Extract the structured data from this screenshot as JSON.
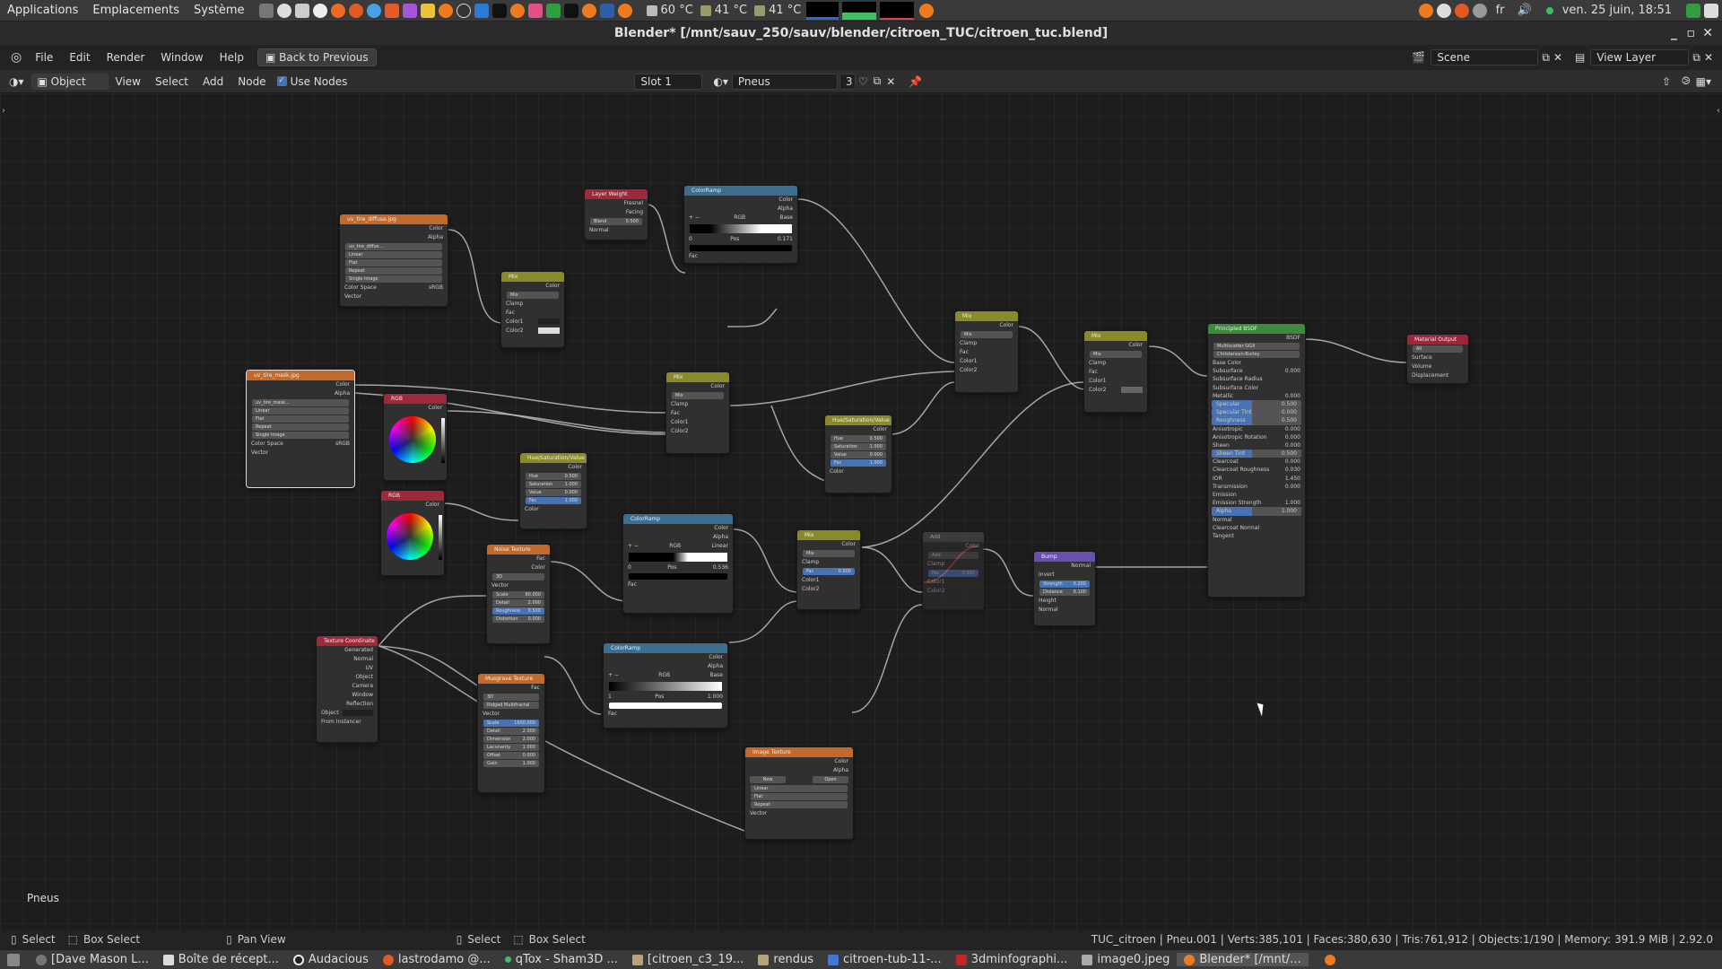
{
  "os_panel": {
    "menus": [
      "Applications",
      "Emplacements",
      "Système"
    ],
    "temps": [
      "60 °C",
      "41 °C",
      "41 °C"
    ],
    "lang": "fr",
    "clock": "ven. 25 juin, 18:51"
  },
  "window": {
    "title": "Blender* [/mnt/sauv_250/sauv/blender/citroen_TUC/citroen_tuc.blend]"
  },
  "topbar": {
    "menus": [
      "File",
      "Edit",
      "Render",
      "Window",
      "Help"
    ],
    "back_button": "Back to Previous",
    "scene": "Scene",
    "view_layer": "View Layer"
  },
  "node_header": {
    "mode": "Object",
    "menus": [
      "View",
      "Select",
      "Add",
      "Node"
    ],
    "use_nodes_label": "Use Nodes",
    "slot": "Slot 1",
    "material": "Pneus",
    "user_count": "3"
  },
  "nodes": {
    "tex_diffuse": {
      "title": "uv_tire_diffuse.jpg",
      "image": "uv_tire_diffus...",
      "outputs": [
        "Color",
        "Alpha"
      ],
      "opts": [
        "Linear",
        "Flat",
        "Repeat",
        "Single Image"
      ],
      "colorspace_label": "Color Space",
      "colorspace": "sRGB",
      "input": "Vector"
    },
    "tex_mask": {
      "title": "uv_tire_mask.jpg",
      "image": "uv_tire_mask...",
      "outputs": [
        "Color",
        "Alpha"
      ],
      "opts": [
        "Linear",
        "Flat",
        "Repeat",
        "Single Image"
      ],
      "colorspace_label": "Color Space",
      "colorspace": "sRGB",
      "input": "Vector"
    },
    "layer_weight": {
      "title": "Layer Weight",
      "outputs": [
        "Fresnel",
        "Facing"
      ],
      "blend_label": "Blend",
      "blend": "0.500",
      "input": "Normal"
    },
    "colorramp1": {
      "title": "ColorRamp",
      "outputs": [
        "Color",
        "Alpha"
      ],
      "mode": "RGB",
      "interp": "Base",
      "index": "0",
      "pos_label": "Pos",
      "pos": "0.171",
      "input": "Fac"
    },
    "mix1": {
      "title": "Mix",
      "output": "Color",
      "blend": "Mix",
      "clamp": "Clamp",
      "inputs": [
        "Fac",
        "Color1",
        "Color2"
      ]
    },
    "rgb1": {
      "title": "RGB",
      "output": "Color"
    },
    "rgb2": {
      "title": "RGB",
      "output": "Color"
    },
    "mix2": {
      "title": "Mix",
      "output": "Color",
      "blend": "Mix",
      "clamp": "Clamp",
      "inputs": [
        "Fac",
        "Color1",
        "Color2"
      ]
    },
    "hsv1": {
      "title": "Hue/Saturation/Value",
      "output": "Color",
      "fields": [
        [
          "Hue",
          "0.500"
        ],
        [
          "Saturation",
          "1.000"
        ],
        [
          "Value",
          "0.000"
        ],
        [
          "Fac",
          "1.000"
        ]
      ],
      "input": "Color"
    },
    "hsv2": {
      "title": "Hue/Saturation/Value",
      "output": "Color",
      "fields": [
        [
          "Hue",
          "0.500"
        ],
        [
          "Saturation",
          "1.000"
        ],
        [
          "Value",
          "0.000"
        ],
        [
          "Fac",
          "1.000"
        ]
      ],
      "input": "Color"
    },
    "mix3": {
      "title": "Mix",
      "output": "Color",
      "blend": "Mix",
      "clamp": "Clamp",
      "inputs": [
        "Fac",
        "Color1",
        "Color2"
      ]
    },
    "mix4": {
      "title": "Mix",
      "output": "Color",
      "blend": "Mix",
      "clamp": "Clamp",
      "inputs": [
        "Fac",
        "Color1",
        "Color2"
      ]
    },
    "noise": {
      "title": "Noise Texture",
      "outputs": [
        "Fac",
        "Color"
      ],
      "dim": "3D",
      "input": "Vector",
      "fields": [
        [
          "Scale",
          "80.000"
        ],
        [
          "Detail",
          "2.000"
        ],
        [
          "Roughness",
          "0.500"
        ],
        [
          "Distortion",
          "0.000"
        ]
      ]
    },
    "colorramp2": {
      "title": "ColorRamp",
      "outputs": [
        "Color",
        "Alpha"
      ],
      "mode": "RGB",
      "interp": "Linear",
      "index": "0",
      "pos_label": "Pos",
      "pos": "0.536",
      "input": "Fac"
    },
    "colorramp3": {
      "title": "ColorRamp",
      "outputs": [
        "Color",
        "Alpha"
      ],
      "mode": "RGB",
      "interp": "Base",
      "index": "1",
      "pos_label": "Pos",
      "pos": "1.000",
      "input": "Fac"
    },
    "mix5": {
      "title": "Mix",
      "output": "Color",
      "blend": "Mix",
      "clamp": "Clamp",
      "fac_label": "Fac",
      "fac": "0.500",
      "inputs": [
        "Color1",
        "Color2"
      ]
    },
    "add": {
      "title": "Add",
      "output": "Color",
      "blend": "Add",
      "clamp": "Clamp",
      "fac_label": "Fac",
      "fac": "0.500",
      "inputs": [
        "Color1",
        "Color2"
      ]
    },
    "bump": {
      "title": "Bump",
      "output": "Normal",
      "invert": "Invert",
      "fields": [
        [
          "Strength",
          "0.200"
        ],
        [
          "Distance",
          "0.100"
        ]
      ],
      "inputs": [
        "Height",
        "Normal"
      ]
    },
    "texcoord": {
      "title": "Texture Coordinate",
      "outputs": [
        "Generated",
        "Normal",
        "UV",
        "Object",
        "Camera",
        "Window",
        "Reflection"
      ],
      "object_label": "Object",
      "from_instancer": "From Instancer"
    },
    "musgrave": {
      "title": "Musgrave Texture",
      "output": "Fac",
      "dim": "3D",
      "type": "Ridged Multifractal",
      "input": "Vector",
      "fields": [
        [
          "Scale",
          "1600.000"
        ],
        [
          "Detail",
          "2.000"
        ],
        [
          "Dimension",
          "2.000"
        ],
        [
          "Lacunarity",
          "1.000"
        ],
        [
          "Offset",
          "0.000"
        ],
        [
          "Gain",
          "1.000"
        ]
      ]
    },
    "image_tex": {
      "title": "Image Texture",
      "outputs": [
        "Color",
        "Alpha"
      ],
      "new": "New",
      "open": "Open",
      "opts": [
        "Linear",
        "Flat",
        "Repeat"
      ],
      "input": "Vector"
    },
    "principled": {
      "title": "Principled BSDF",
      "output": "BSDF",
      "dist": "Multiscatter GGX",
      "sss": "Christensen-Burley",
      "fields": [
        [
          "Base Color",
          ""
        ],
        [
          "Subsurface",
          "0.000"
        ],
        [
          "Subsurface Radius",
          ""
        ],
        [
          "Subsurface Color",
          ""
        ],
        [
          "Metallic",
          "0.000"
        ],
        [
          "Specular",
          "0.500"
        ],
        [
          "Specular Tint",
          "0.000"
        ],
        [
          "Roughness",
          "0.500"
        ],
        [
          "Anisotropic",
          "0.000"
        ],
        [
          "Anisotropic Rotation",
          "0.000"
        ],
        [
          "Sheen",
          "0.000"
        ],
        [
          "Sheen Tint",
          "0.500"
        ],
        [
          "Clearcoat",
          "0.000"
        ],
        [
          "Clearcoat Roughness",
          "0.030"
        ],
        [
          "IOR",
          "1.450"
        ],
        [
          "Transmission",
          "0.000"
        ],
        [
          "Emission",
          ""
        ],
        [
          "Emission Strength",
          "1.000"
        ],
        [
          "Alpha",
          "1.000"
        ],
        [
          "Normal",
          ""
        ],
        [
          "Clearcoat Normal",
          ""
        ],
        [
          "Tangent",
          ""
        ]
      ]
    },
    "output": {
      "title": "Material Output",
      "target": "All",
      "inputs": [
        "Surface",
        "Volume",
        "Displacement"
      ]
    }
  },
  "editor_label": "Pneus",
  "statusbar": {
    "items": [
      "Select",
      "Box Select",
      "Pan View",
      "Select",
      "Box Select"
    ],
    "stats": "TUC_citroen | Pneu.001 | Verts:385,101 | Faces:380,630 | Tris:761,912 | Objects:1/190 | Memory: 391.9 MiB | 2.92.0"
  },
  "taskbar": {
    "tasks": [
      "[Dave Mason L...",
      "Boîte de récept...",
      "Audacious",
      "lastrodamo @...",
      "qTox - Sham3D ...",
      "[citroen_c3_19...",
      "rendus",
      "citroen-tub-11-...",
      "3dminfographi...",
      "image0.jpeg",
      "Blender* [/mnt/..."
    ]
  }
}
